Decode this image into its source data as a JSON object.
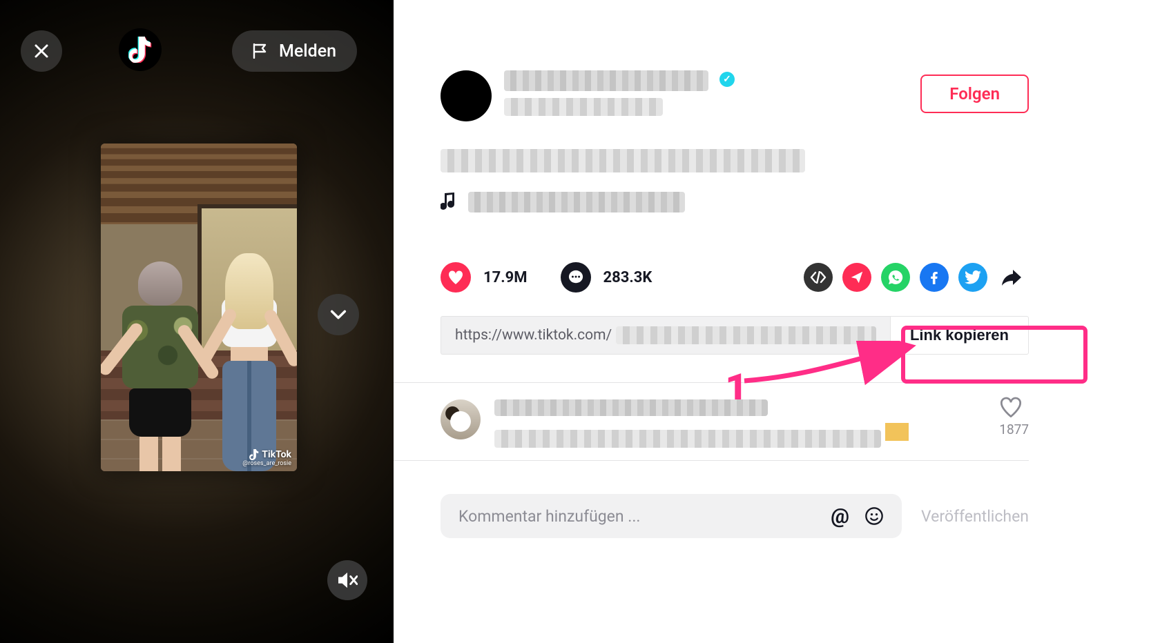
{
  "video": {
    "report_label": "Melden",
    "watermark_brand": "TikTok",
    "watermark_handle": "@roses_are_rosie"
  },
  "profile": {
    "follow_label": "Folgen",
    "verified": true,
    "likes": "17.9M",
    "comments": "283.3K"
  },
  "link": {
    "url_visible": "https://www.tiktok.com/",
    "copy_label": "Link kopieren"
  },
  "top_comment": {
    "like_count": "1877"
  },
  "compose": {
    "placeholder": "Kommentar hinzufügen ...",
    "publish_label": "Veröffentlichen"
  },
  "annotation": {
    "step": "1"
  }
}
